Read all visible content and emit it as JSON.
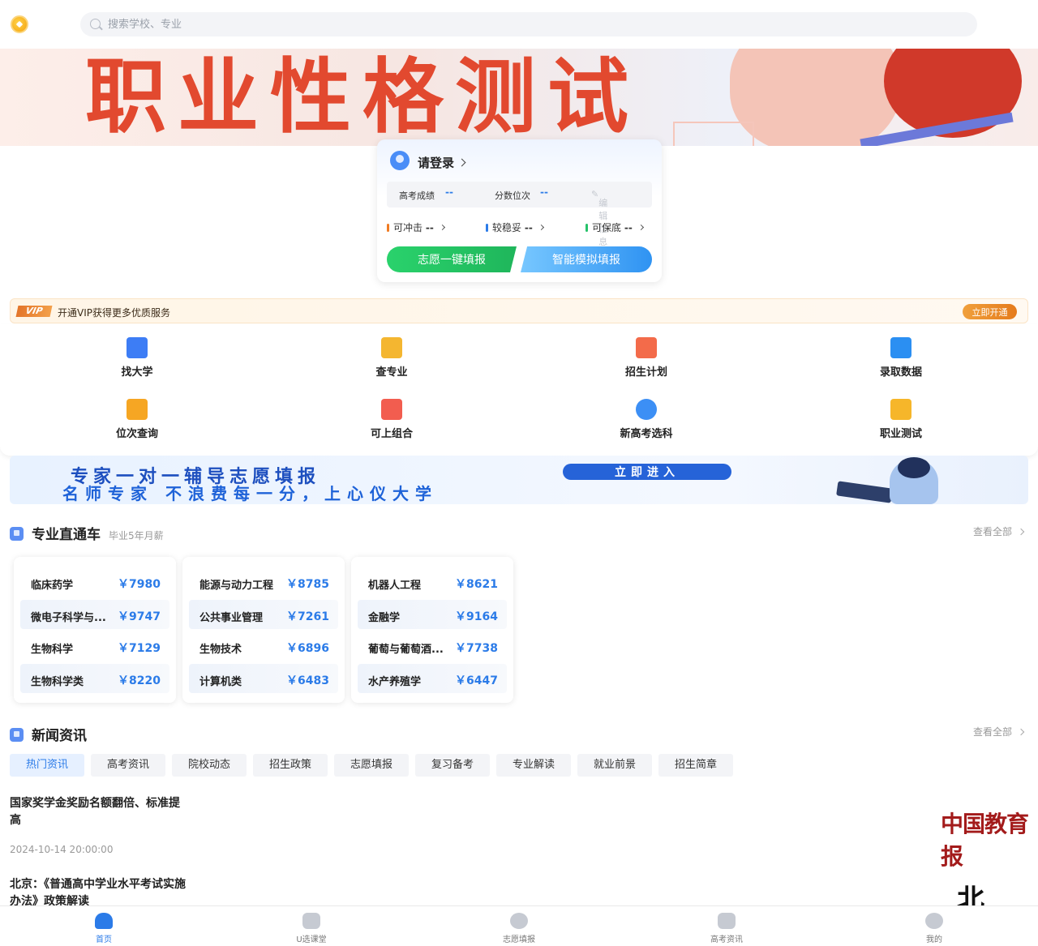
{
  "search": {
    "placeholder": "搜索学校、专业"
  },
  "hero": {
    "title": "职业性格测试"
  },
  "login_card": {
    "login_label": "请登录",
    "score_label": "高考成绩",
    "score_value": "--",
    "rank_label": "分数位次",
    "rank_value": "--",
    "edit_label": "编辑信息",
    "chances": [
      {
        "label": "可冲击",
        "value": "--",
        "color": "#f07b22"
      },
      {
        "label": "较稳妥",
        "value": "--",
        "color": "#2b7be8"
      },
      {
        "label": "可保底",
        "value": "--",
        "color": "#26c26a"
      }
    ],
    "btn_one_click": "志愿一键填报",
    "btn_simulate": "智能模拟填报"
  },
  "vip": {
    "badge": "VIP",
    "text": "开通VIP获得更多优质服务",
    "button": "立即开通"
  },
  "menu": [
    {
      "label": "找大学",
      "icon": "university-icon",
      "color": "#3d7df5"
    },
    {
      "label": "查专业",
      "icon": "major-book-icon",
      "color": "#f4b630"
    },
    {
      "label": "招生计划",
      "icon": "enrollment-plan-icon",
      "color": "#f36b4a"
    },
    {
      "label": "录取数据",
      "icon": "admission-data-icon",
      "color": "#2b8ff2"
    },
    {
      "label": "位次查询",
      "icon": "rank-query-icon",
      "color": "#f6a623"
    },
    {
      "label": "可上组合",
      "icon": "combination-icon",
      "color": "#f25d4f"
    },
    {
      "label": "新高考选科",
      "icon": "subject-selection-icon",
      "color": "#3c8ff5"
    },
    {
      "label": "职业测试",
      "icon": "career-test-icon",
      "color": "#f6b62a"
    }
  ],
  "expert_banner": {
    "line1": "专家一对一辅导志愿填报",
    "line2": "名师专家 不浪费每一分，上心仪大学",
    "button": "立即进入"
  },
  "majors_section": {
    "title": "专业直通车",
    "subtitle": "毕业5年月薪",
    "view_all": "查看全部",
    "columns": [
      [
        {
          "name": "临床药学",
          "salary": "￥7980"
        },
        {
          "name": "微电子科学与...",
          "salary": "￥9747"
        },
        {
          "name": "生物科学",
          "salary": "￥7129"
        },
        {
          "name": "生物科学类",
          "salary": "￥8220"
        }
      ],
      [
        {
          "name": "能源与动力工程",
          "salary": "￥8785"
        },
        {
          "name": "公共事业管理",
          "salary": "￥7261"
        },
        {
          "name": "生物技术",
          "salary": "￥6896"
        },
        {
          "name": "计算机类",
          "salary": "￥6483"
        }
      ],
      [
        {
          "name": "机器人工程",
          "salary": "￥8621"
        },
        {
          "name": "金融学",
          "salary": "￥9164"
        },
        {
          "name": "葡萄与葡萄酒...",
          "salary": "￥7738"
        },
        {
          "name": "水产养殖学",
          "salary": "￥6447"
        }
      ]
    ]
  },
  "news_section": {
    "title": "新闻资讯",
    "view_all": "查看全部",
    "tabs": [
      "热门资讯",
      "高考资讯",
      "院校动态",
      "招生政策",
      "志愿填报",
      "复习备考",
      "专业解读",
      "就业前景",
      "招生简章"
    ],
    "items": [
      {
        "title": "国家奖学金奖励名额翻倍、标准提高",
        "date": "2024-10-14 20:00:00",
        "source_logo": "中国教育报"
      },
      {
        "title": "北京：《普通高中学业水平考试实施办法》政策解读",
        "date": "",
        "source_logo": "北"
      }
    ]
  },
  "bottom_nav": [
    {
      "label": "首页",
      "icon": "home-icon"
    },
    {
      "label": "U选课堂",
      "icon": "classroom-icon"
    },
    {
      "label": "志愿填报",
      "icon": "volunteer-icon"
    },
    {
      "label": "高考资讯",
      "icon": "news-icon"
    },
    {
      "label": "我的",
      "icon": "profile-icon"
    }
  ]
}
